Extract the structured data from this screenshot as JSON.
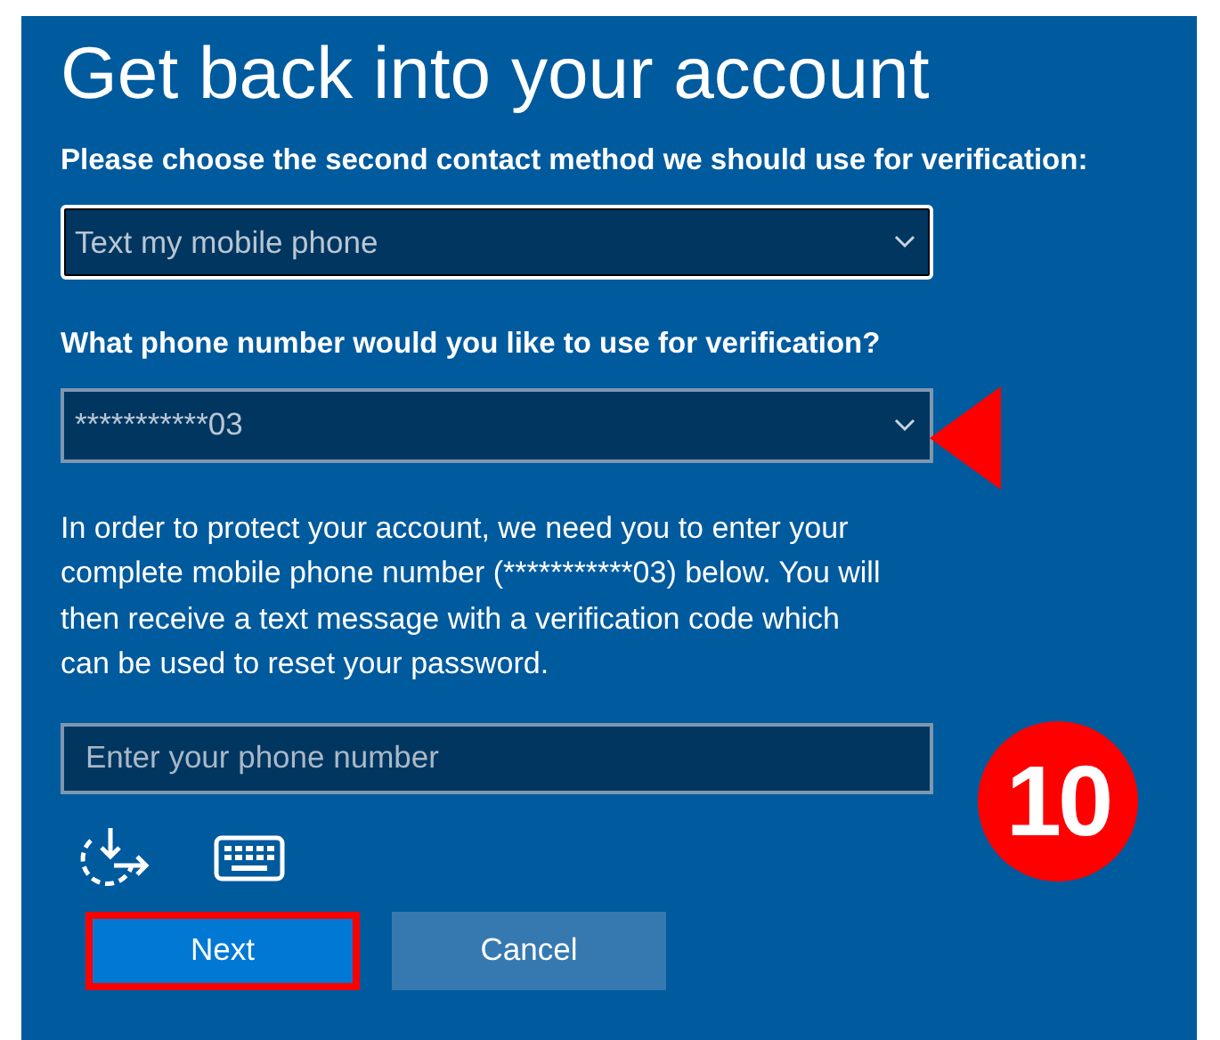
{
  "title": "Get back into your account",
  "method_label": "Please choose the second contact method we should use for verification:",
  "method_select": {
    "value": "Text my mobile phone",
    "focused": true
  },
  "phone_label": "What phone number would you like to use for verification?",
  "phone_select": {
    "value": "***********03",
    "focused": false
  },
  "instructions": "In order to protect your account, we need you to enter your complete mobile phone number (***********03) below. You will then receive a text message with a verification code which can be used to reset your password.",
  "phone_input": {
    "placeholder": "Enter your phone number"
  },
  "buttons": [
    {
      "label": "Next",
      "kind": "primary",
      "highlighted": true
    },
    {
      "label": "Cancel",
      "kind": "secondary",
      "highlighted": false
    }
  ],
  "step_badge": "10"
}
